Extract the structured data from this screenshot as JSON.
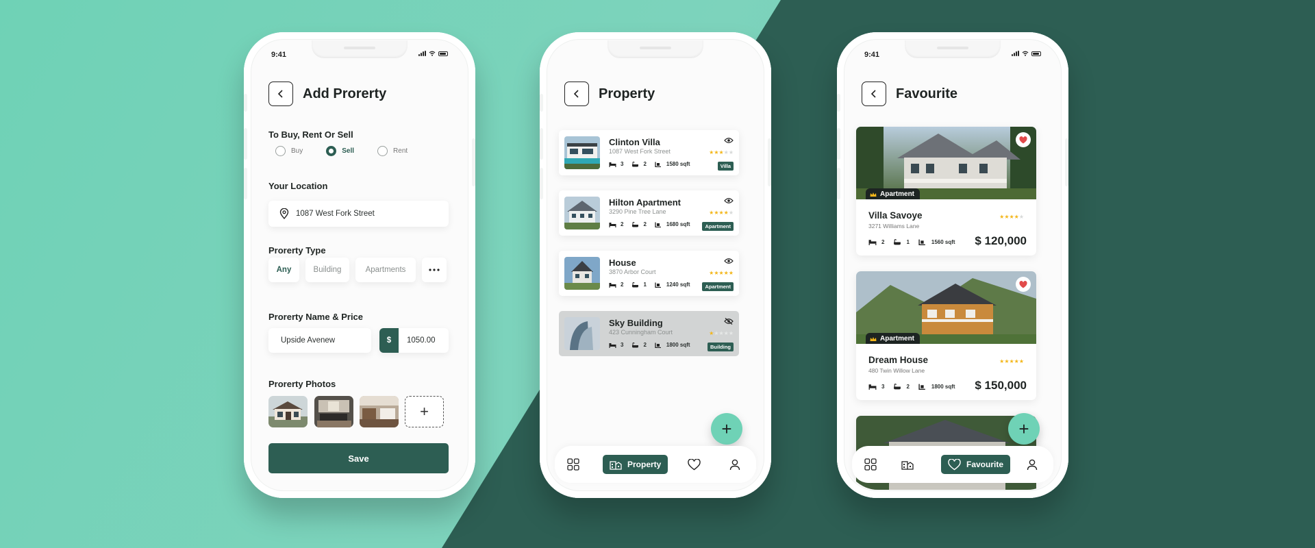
{
  "colors": {
    "brand_dark": "#2d5e53",
    "brand_light": "#6fd2b6",
    "star": "#f3b619",
    "heart": "#e14a4a"
  },
  "status": {
    "time": "9:41"
  },
  "add_property": {
    "title": "Add Prorerty",
    "deal_label": "To Buy, Rent Or Sell",
    "deal_options": [
      "Buy",
      "Sell",
      "Rent"
    ],
    "deal_selected": "Sell",
    "location_label": "Your Location",
    "location_value": "1087  West Fork Street",
    "type_label": "Prorerty Type",
    "type_options": [
      "Any",
      "Building",
      "Apartments"
    ],
    "type_selected": "Any",
    "name_price_label": "Prorerty Name & Price",
    "name_value": "Upside Avenew",
    "currency_symbol": "$",
    "price_value": "1050.00",
    "photos_label": "Prorerty Photos",
    "add_photo_symbol": "+",
    "save_label": "Save"
  },
  "property": {
    "title": "Property",
    "items": [
      {
        "name": "Clinton Villa",
        "address": "1087  West Fork Street",
        "beds": "3",
        "baths": "2",
        "area": "1580 sqft",
        "tag": "Villa",
        "rating": 3,
        "hidden": false
      },
      {
        "name": "Hilton Apartment",
        "address": "3290  Pine Tree Lane",
        "beds": "2",
        "baths": "2",
        "area": "1680 sqft",
        "tag": "Apartment",
        "rating": 4,
        "hidden": false
      },
      {
        "name": "House",
        "address": "3870  Arbor Court",
        "beds": "2",
        "baths": "1",
        "area": "1240 sqft",
        "tag": "Apartment",
        "rating": 5,
        "hidden": false
      },
      {
        "name": "Sky Building",
        "address": "423  Cunningham Court",
        "beds": "3",
        "baths": "2",
        "area": "1800 sqft",
        "tag": "Building",
        "rating": 1,
        "hidden": true
      }
    ],
    "fab_symbol": "+",
    "nav_active_label": "Property"
  },
  "favourite": {
    "title": "Favourite",
    "items": [
      {
        "tag": "Apartment",
        "name": "Villa Savoye",
        "address": "3271  Williams Lane",
        "beds": "2",
        "baths": "1",
        "area": "1560 sqft",
        "price": "$ 120,000",
        "rating": 4
      },
      {
        "tag": "Apartment",
        "name": "Dream House",
        "address": "480  Twin Willow Lane",
        "beds": "3",
        "baths": "2",
        "area": "1800 sqft",
        "price": "$ 150,000",
        "rating": 5
      }
    ],
    "fab_symbol": "+",
    "nav_active_label": "Favourite"
  }
}
